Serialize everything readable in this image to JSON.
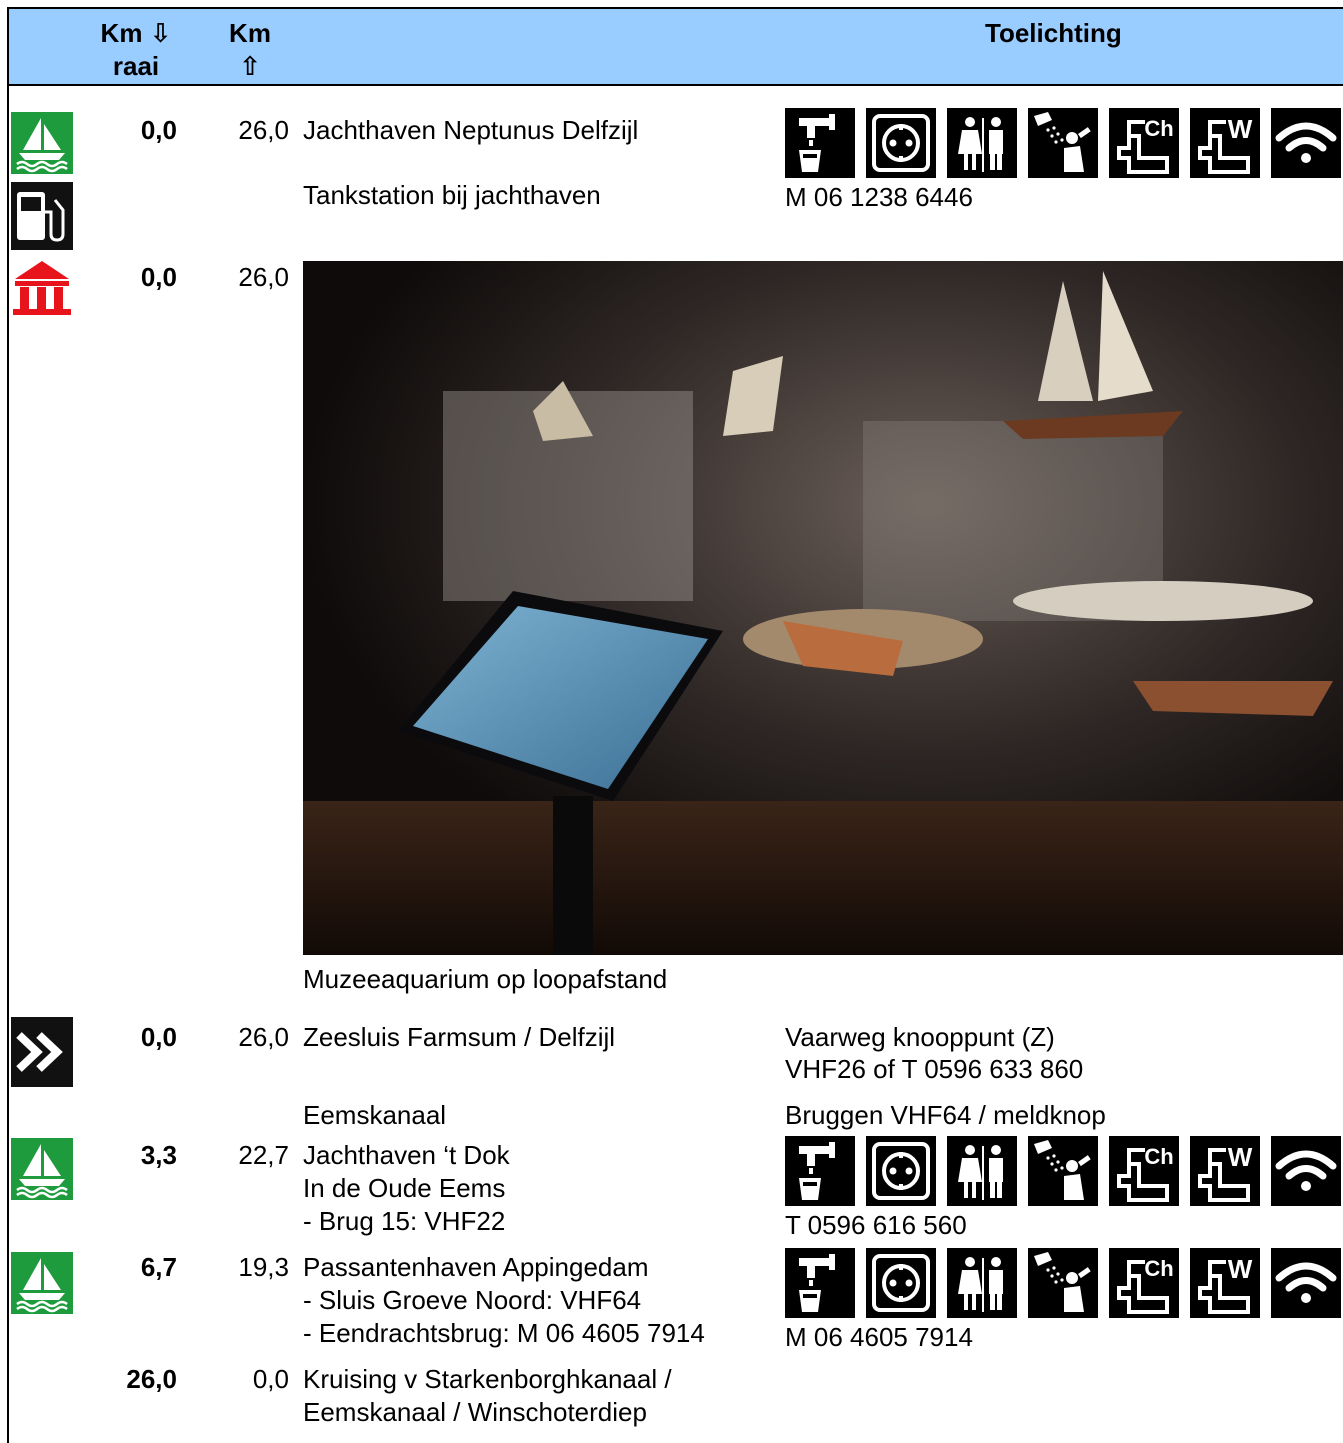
{
  "header": {
    "km_down_label": "Km ⇩",
    "km_down_sub": "raai",
    "km_up_label": "Km",
    "km_up_arrow": "⇧",
    "explanation_label": "Toelichting"
  },
  "colors": {
    "header_bg": "#99ccff",
    "marina_green": "#1e9b3c",
    "museum_red": "#e8141c"
  },
  "icons": {
    "marina": "sailboat-icon",
    "fuel": "fuel-pump-icon",
    "museum": "museum-icon",
    "waterway_junction": "double-chevron-icon",
    "facilities": [
      "water-tap-icon",
      "power-outlet-icon",
      "toilets-icon",
      "shower-icon",
      "chemical-toilet-disposal-icon",
      "waste-water-pumpout-icon",
      "wifi-icon"
    ],
    "facility_labels": {
      "chemical": "Ch",
      "waste": "W"
    }
  },
  "rows": [
    {
      "km_down": "0,0",
      "km_up": "26,0",
      "lines": [
        "Jachthaven Neptunus Delfzijl"
      ],
      "note": []
    },
    {
      "lines": [
        "Tankstation bij jachthaven"
      ],
      "note": [
        "M 06 1238 6446"
      ]
    },
    {
      "km_down": "0,0",
      "km_up": "26,0",
      "caption": "Muzeeaquarium op loopafstand"
    },
    {
      "km_down": "0,0",
      "km_up": "26,0",
      "lines": [
        "Zeesluis Farmsum / Delfzijl"
      ],
      "note": [
        "Vaarweg knooppunt (Z)",
        "VHF26 of T 0596 633 860"
      ]
    },
    {
      "lines": [
        "Eemskanaal"
      ],
      "note": [
        "Bruggen VHF64 / meldknop"
      ]
    },
    {
      "km_down": "3,3",
      "km_up": "22,7",
      "lines": [
        "Jachthaven ‘t Dok",
        "In de Oude Eems",
        "- Brug 15: VHF22"
      ],
      "note": [
        "T 0596 616 560"
      ]
    },
    {
      "km_down": "6,7",
      "km_up": "19,3",
      "lines": [
        "Passantenhaven Appingedam",
        "- Sluis Groeve Noord: VHF64",
        "- Eendrachtsbrug: M 06 4605 7914"
      ],
      "note": [
        "M 06 4605 7914"
      ]
    },
    {
      "km_down": "26,0",
      "km_up": "0,0",
      "lines": [
        "Kruising v Starkenborghkanaal /",
        "Eemskanaal / Winschoterdiep"
      ]
    }
  ]
}
